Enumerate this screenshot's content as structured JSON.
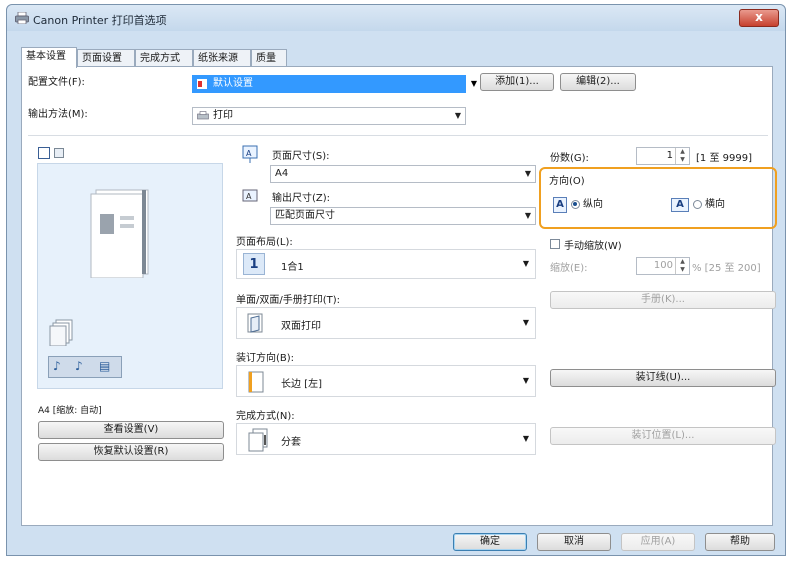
{
  "window": {
    "title": "Canon Printer 打印首选项",
    "close": "x"
  },
  "tabs": [
    "基本设置",
    "页面设置",
    "完成方式",
    "纸张来源",
    "质量"
  ],
  "profile": {
    "label": "配置文件(F):",
    "value": "默认设置",
    "add_button": "添加(1)...",
    "edit_button": "编辑(2)..."
  },
  "output_method": {
    "label": "输出方法(M):",
    "value": "打印"
  },
  "preview": {
    "caption": "A4 [缩放: 自动]",
    "view_settings_button": "查看设置(V)",
    "restore_defaults_button": "恢复默认设置(R)"
  },
  "page_size": {
    "label": "页面尺寸(S):",
    "value": "A4"
  },
  "output_size": {
    "label": "输出尺寸(Z):",
    "value": "匹配页面尺寸"
  },
  "page_layout": {
    "label": "页面布局(L):",
    "value": "1合1",
    "number": "1"
  },
  "print_mode": {
    "label": "单面/双面/手册打印(T):",
    "value": "双面打印"
  },
  "binding": {
    "label": "装订方向(B):",
    "value": "长边 [左]"
  },
  "finishing": {
    "label": "完成方式(N):",
    "value": "分套"
  },
  "copies": {
    "label": "份数(G):",
    "value": "1",
    "range": "[1 至 9999]"
  },
  "orientation": {
    "label": "方向(O)",
    "portrait": "纵向",
    "landscape": "横向",
    "selected": "portrait"
  },
  "manual_scaling": {
    "label": "手动缩放(W)",
    "scale_label": "缩放(E):",
    "value": "100",
    "range": "% [25 至 200]"
  },
  "booklet_button": "手册(K)...",
  "gutter_button": "装订线(U)...",
  "staple_position_button": "装订位置(L)...",
  "footer": {
    "ok": "确定",
    "cancel": "取消",
    "apply": "应用(A)",
    "help": "帮助"
  },
  "colors": {
    "highlight": "#f0a020",
    "selection": "#3399ff",
    "window_frame": "#cfe0f1"
  }
}
